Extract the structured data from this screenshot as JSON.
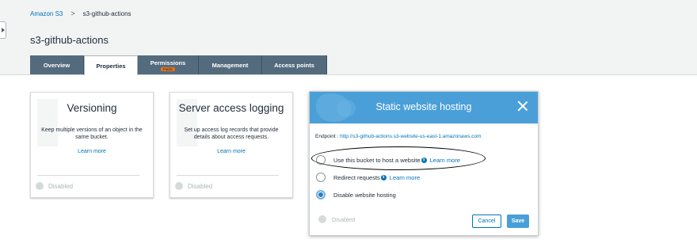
{
  "breadcrumb": {
    "root": "Amazon S3",
    "separator": ">",
    "current": "s3-github-actions"
  },
  "page_title": "s3-github-actions",
  "tabs": [
    {
      "label": "Overview",
      "active": false
    },
    {
      "label": "Properties",
      "active": true
    },
    {
      "label": "Permissions",
      "badge": "Public",
      "active": false
    },
    {
      "label": "Management",
      "active": false
    },
    {
      "label": "Access points",
      "active": false
    }
  ],
  "cards": [
    {
      "title": "Versioning",
      "description": "Keep multiple versions of an object in the same bucket.",
      "link": "Learn more",
      "status": "Disabled"
    },
    {
      "title": "Server access logging",
      "description": "Set up access log records that provide details about access requests.",
      "link": "Learn more",
      "status": "Disabled"
    }
  ],
  "static_hosting": {
    "title": "Static website hosting",
    "endpoint_label": "Endpoint : ",
    "endpoint_url": "http://s3-github-actions.s3-website-us-east-1.amazonaws.com",
    "options": [
      {
        "label": "Use this bucket to host a website",
        "link": "Learn more",
        "checked": false
      },
      {
        "label": "Redirect requests",
        "link": "Learn more",
        "checked": false
      },
      {
        "label": "Disable website hosting",
        "checked": true
      }
    ],
    "status": "Disabled",
    "cancel_label": "Cancel",
    "save_label": "Save"
  },
  "colors": {
    "link": "#0073bb",
    "tab_bg": "#546b7e",
    "panel_header": "#4a9fd8",
    "badge": "#ec7211"
  }
}
